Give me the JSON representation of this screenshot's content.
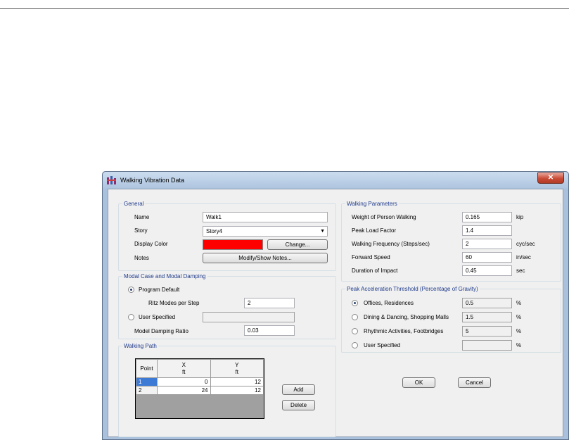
{
  "window": {
    "title": "Walking Vibration Data",
    "close_glyph": "✕"
  },
  "general": {
    "title": "General",
    "name_label": "Name",
    "name_value": "Walk1",
    "story_label": "Story",
    "story_value": "Story4",
    "display_color_label": "Display Color",
    "display_color": "#ff0000",
    "change_label": "Change...",
    "notes_label": "Notes",
    "notes_button": "Modify/Show Notes..."
  },
  "modal": {
    "title": "Modal Case and Modal Damping",
    "program_default_label": "Program Default",
    "ritz_label": "Ritz Modes per Step",
    "ritz_value": "2",
    "user_specified_label": "User Specified",
    "user_specified_value": "",
    "damping_label": "Model Damping Ratio",
    "damping_value": "0.03",
    "selected": "Program Default"
  },
  "walking_path": {
    "title": "Walking Path",
    "columns": [
      {
        "name": "Point",
        "unit": ""
      },
      {
        "name": "X",
        "unit": "ft"
      },
      {
        "name": "Y",
        "unit": "ft"
      }
    ],
    "rows": [
      {
        "point": "1",
        "x": "0",
        "y": "12"
      },
      {
        "point": "2",
        "x": "24",
        "y": "12"
      }
    ],
    "add_label": "Add",
    "delete_label": "Delete"
  },
  "walking_params": {
    "title": "Walking Parameters",
    "weight_label": "Weight of Person Walking",
    "weight_value": "0.165",
    "weight_unit": "kip",
    "peak_label": "Peak Load Factor",
    "peak_value": "1.4",
    "freq_label": "Walking Frequency (Steps/sec)",
    "freq_value": "2",
    "freq_unit": "cyc/sec",
    "speed_label": "Forward Speed",
    "speed_value": "60",
    "speed_unit": "in/sec",
    "duration_label": "Duration of Impact",
    "duration_value": "0.45",
    "duration_unit": "sec"
  },
  "threshold": {
    "title": "Peak Acceleration Threshold  (Percentage of Gravity)",
    "options": [
      {
        "label": "Offices, Residences",
        "value": "0.5",
        "unit": "%"
      },
      {
        "label": "Dining & Dancing, Shopping Malls",
        "value": "1.5",
        "unit": "%"
      },
      {
        "label": "Rhythmic Activities, Footbridges",
        "value": "5",
        "unit": "%"
      },
      {
        "label": "User Specified",
        "value": "",
        "unit": "%"
      }
    ],
    "selected": "Offices, Residences"
  },
  "buttons": {
    "ok": "OK",
    "cancel": "Cancel"
  }
}
